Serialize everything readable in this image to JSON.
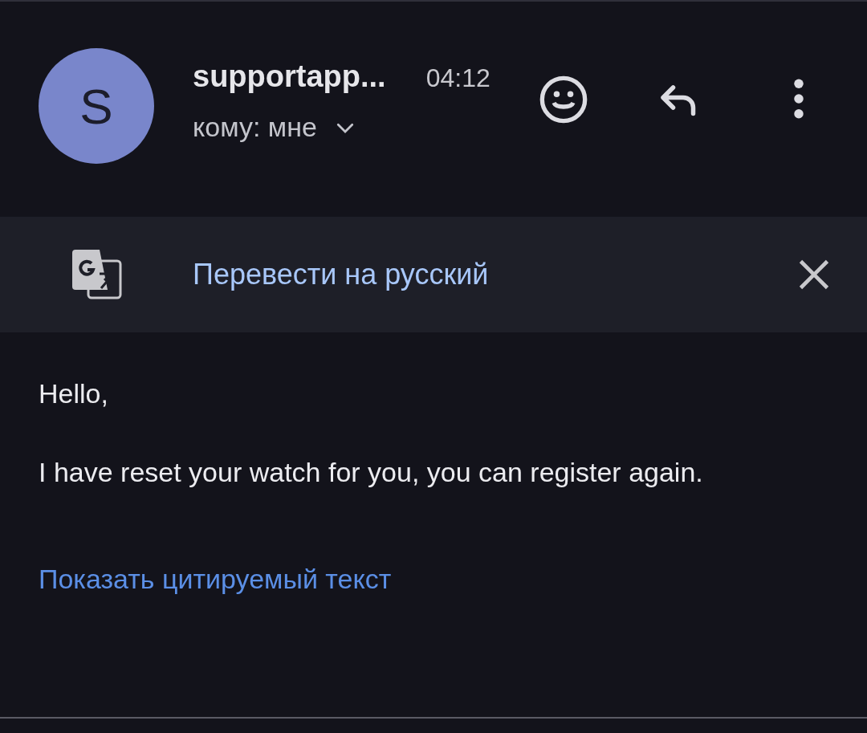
{
  "message": {
    "avatar_letter": "S",
    "sender": "supportapp...",
    "time": "04:12",
    "recipient": "кому: мне"
  },
  "translate_bar": {
    "label": "Перевести на русский"
  },
  "body": [
    "Hello,",
    "I have reset your watch for you, you can register again."
  ],
  "show_quoted_link": "Показать цитируемый текст"
}
